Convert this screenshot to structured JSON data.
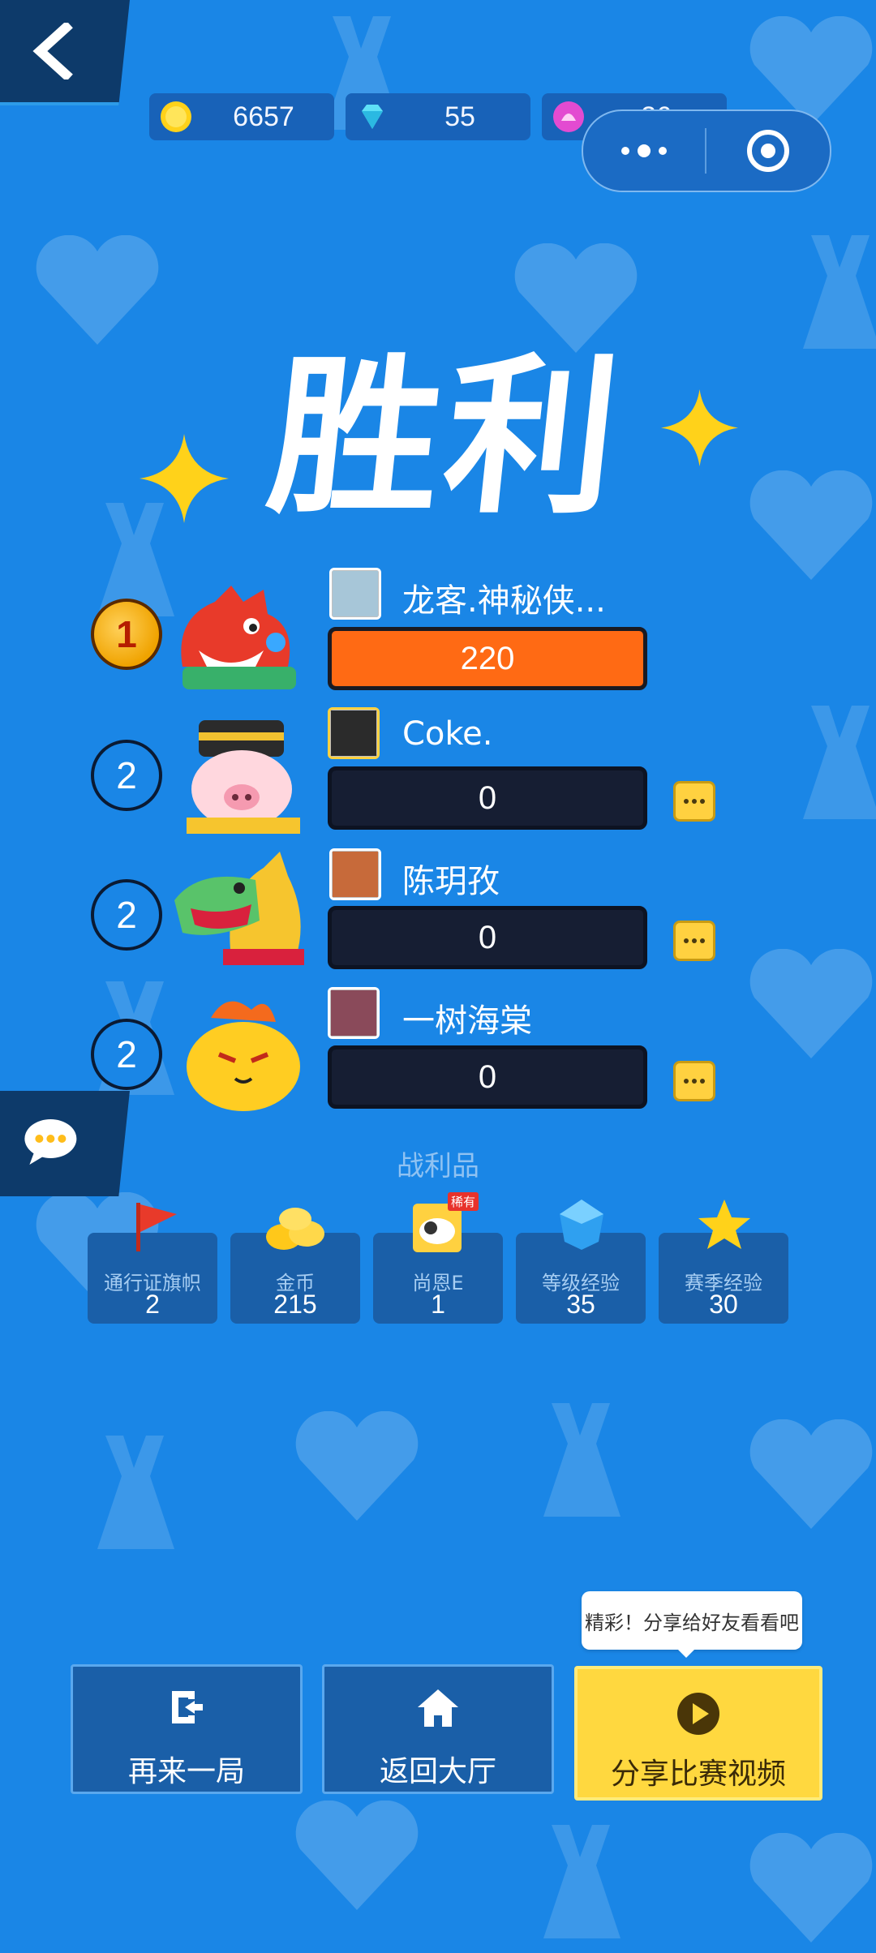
{
  "currency": {
    "coins": "6657",
    "diamonds": "55",
    "tickets": "26"
  },
  "title": "胜利",
  "players": [
    {
      "rank": "1",
      "name": "龙客.神秘侠...",
      "score": "220"
    },
    {
      "rank": "2",
      "name": "Coke.",
      "score": "0"
    },
    {
      "rank": "2",
      "name": "陈玥孜",
      "score": "0"
    },
    {
      "rank": "2",
      "name": "一树海棠",
      "score": "0"
    }
  ],
  "spoils": {
    "title": "战利品",
    "rare_tag": "稀有",
    "items": [
      {
        "label": "通行证旗帜",
        "value": "2"
      },
      {
        "label": "金币",
        "value": "215"
      },
      {
        "label": "尚恩E",
        "value": "1"
      },
      {
        "label": "等级经验",
        "value": "35"
      },
      {
        "label": "赛季经验",
        "value": "30"
      }
    ]
  },
  "buttons": {
    "replay": "再来一局",
    "lobby": "返回大厅",
    "share": "分享比赛视频"
  },
  "tooltip": "精彩！分享给好友看看吧",
  "colors": {
    "background": "#1a86e6",
    "winner_bar": "#ff6a14",
    "share_button": "#ffd83f"
  }
}
